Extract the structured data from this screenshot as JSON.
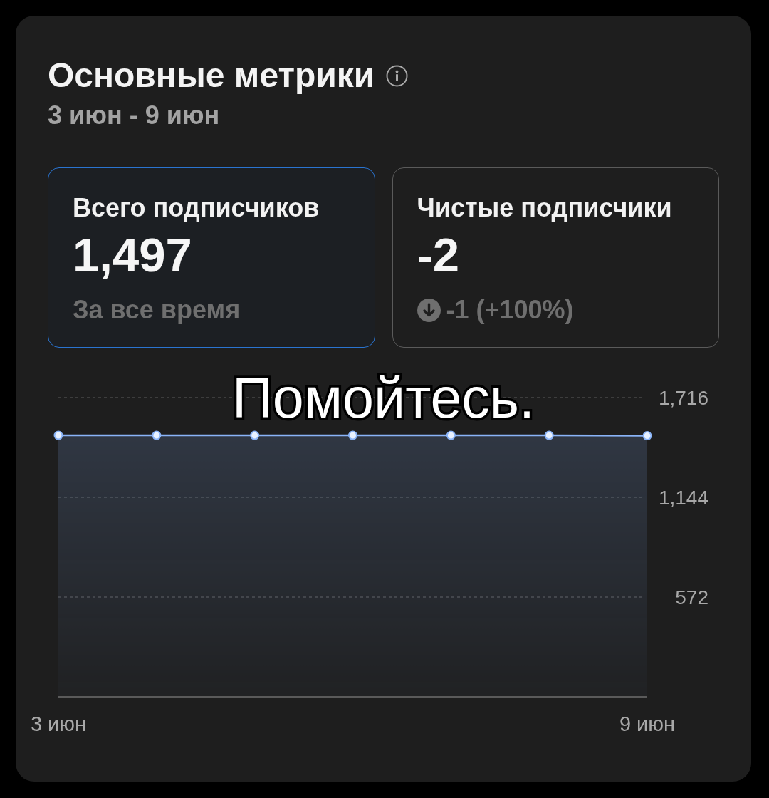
{
  "card": {
    "title": "Основные метрики",
    "date_range": "3 июн - 9 июн"
  },
  "metrics": [
    {
      "label": "Всего подписчиков",
      "value": "1,497",
      "note": "За все время",
      "selected": true
    },
    {
      "label": "Чистые подписчики",
      "value": "-2",
      "change": {
        "down": true,
        "text": "-1 (+100%)"
      },
      "selected": false
    }
  ],
  "chart": {
    "chart_data": {
      "type": "area",
      "categories": [
        "3 июн",
        null,
        null,
        null,
        null,
        null,
        "9 июн"
      ],
      "series": [
        {
          "color": "#8ab4f8",
          "values": [
            1499,
            1499,
            1499,
            1499,
            1499,
            1499,
            1497
          ]
        }
      ],
      "ylim": [
        0,
        1716
      ],
      "yticks": [
        {
          "value": 572,
          "label": "572"
        },
        {
          "value": 1144,
          "label": "1,144"
        },
        {
          "value": 1716,
          "label": "1,716"
        }
      ]
    }
  },
  "caption": "Помойтесь."
}
